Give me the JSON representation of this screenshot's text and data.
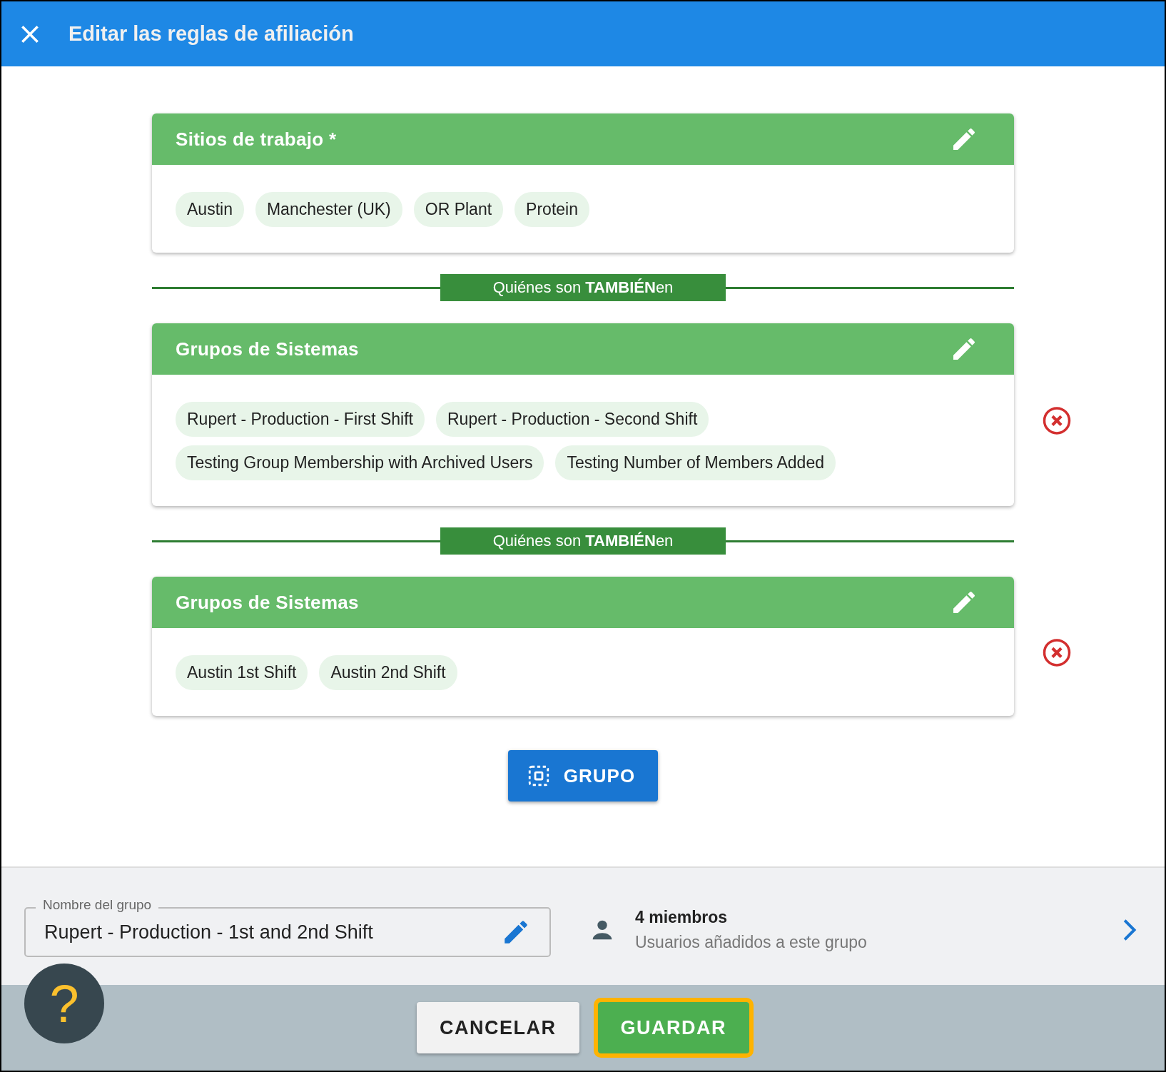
{
  "header": {
    "title": "Editar las reglas de afiliación"
  },
  "rules": [
    {
      "title": "Sitios de trabajo *",
      "removable": false,
      "chips": [
        "Austin",
        "Manchester (UK)",
        "OR Plant",
        "Protein"
      ]
    },
    {
      "connector": "Quiénes son **TAMBIÉN**en",
      "title": "Grupos de Sistemas",
      "removable": true,
      "chips": [
        "Rupert - Production - First Shift",
        "Rupert - Production - Second Shift",
        "Testing Group Membership with Archived Users",
        "Testing Number of Members Added"
      ]
    },
    {
      "connector": "Quiénes son **TAMBIÉN**en",
      "title": "Grupos de Sistemas",
      "removable": true,
      "chips": [
        "Austin 1st Shift",
        "Austin 2nd Shift"
      ]
    }
  ],
  "add_button": "GRUPO",
  "group_name": {
    "label": "Nombre del grupo",
    "value": "Rupert - Production - 1st and 2nd Shift"
  },
  "members": {
    "count": "4 miembros",
    "subtitle": "Usuarios añadidos a este grupo"
  },
  "footer": {
    "help": "?",
    "buttons": [
      {
        "label": "CANCELAR",
        "kind": "secondary",
        "highlighted": false
      },
      {
        "label": "GUARDAR",
        "kind": "primary",
        "highlighted": true
      }
    ]
  }
}
